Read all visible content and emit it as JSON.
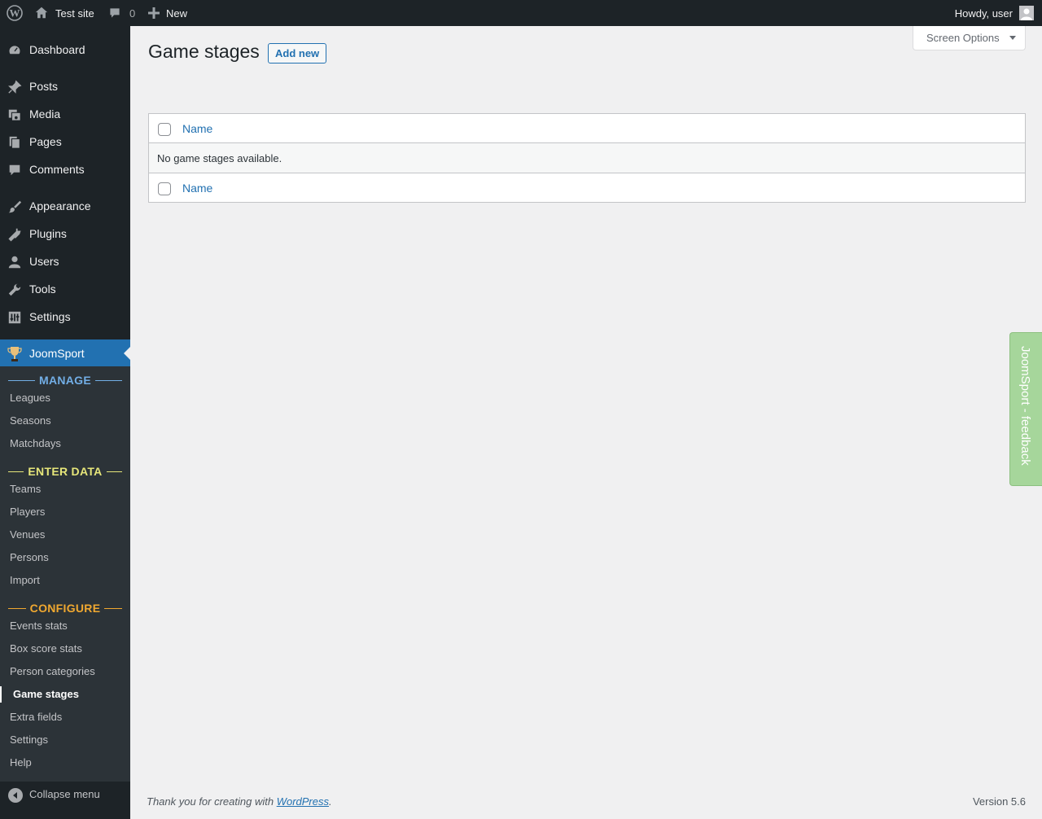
{
  "adminbar": {
    "site_name": "Test site",
    "comments_count": "0",
    "new_label": "New",
    "howdy": "Howdy, user"
  },
  "menu": {
    "dashboard": "Dashboard",
    "posts": "Posts",
    "media": "Media",
    "pages": "Pages",
    "comments": "Comments",
    "appearance": "Appearance",
    "plugins": "Plugins",
    "users": "Users",
    "tools": "Tools",
    "settings": "Settings",
    "joomsport": "JoomSport",
    "collapse": "Collapse menu"
  },
  "submenu": {
    "manage_heading": "MANAGE",
    "manage_color": "#72aee6",
    "leagues": "Leagues",
    "seasons": "Seasons",
    "matchdays": "Matchdays",
    "enter_heading": "ENTER DATA",
    "enter_color": "#e6e67a",
    "teams": "Teams",
    "players": "Players",
    "venues": "Venues",
    "persons": "Persons",
    "import": "Import",
    "configure_heading": "CONFIGURE",
    "configure_color": "#f0a830",
    "events_stats": "Events stats",
    "box_score_stats": "Box score stats",
    "person_categories": "Person categories",
    "game_stages": "Game stages",
    "extra_fields": "Extra fields",
    "settings": "Settings",
    "help": "Help"
  },
  "main": {
    "screen_options": "Screen Options",
    "title": "Game stages",
    "add_new": "Add new",
    "column_name": "Name",
    "empty_message": "No game stages available."
  },
  "feedback_tab": "JoomSport - feedback",
  "footer": {
    "thanks_prefix": "Thank you for creating with ",
    "wordpress_link": "WordPress",
    "thanks_suffix": ".",
    "version": "Version 5.6"
  },
  "colors": {
    "accent": "#2271b1",
    "menu_bg": "#1d2327",
    "submenu_bg": "#2c3338",
    "feedback_bg": "#a6d69b"
  }
}
